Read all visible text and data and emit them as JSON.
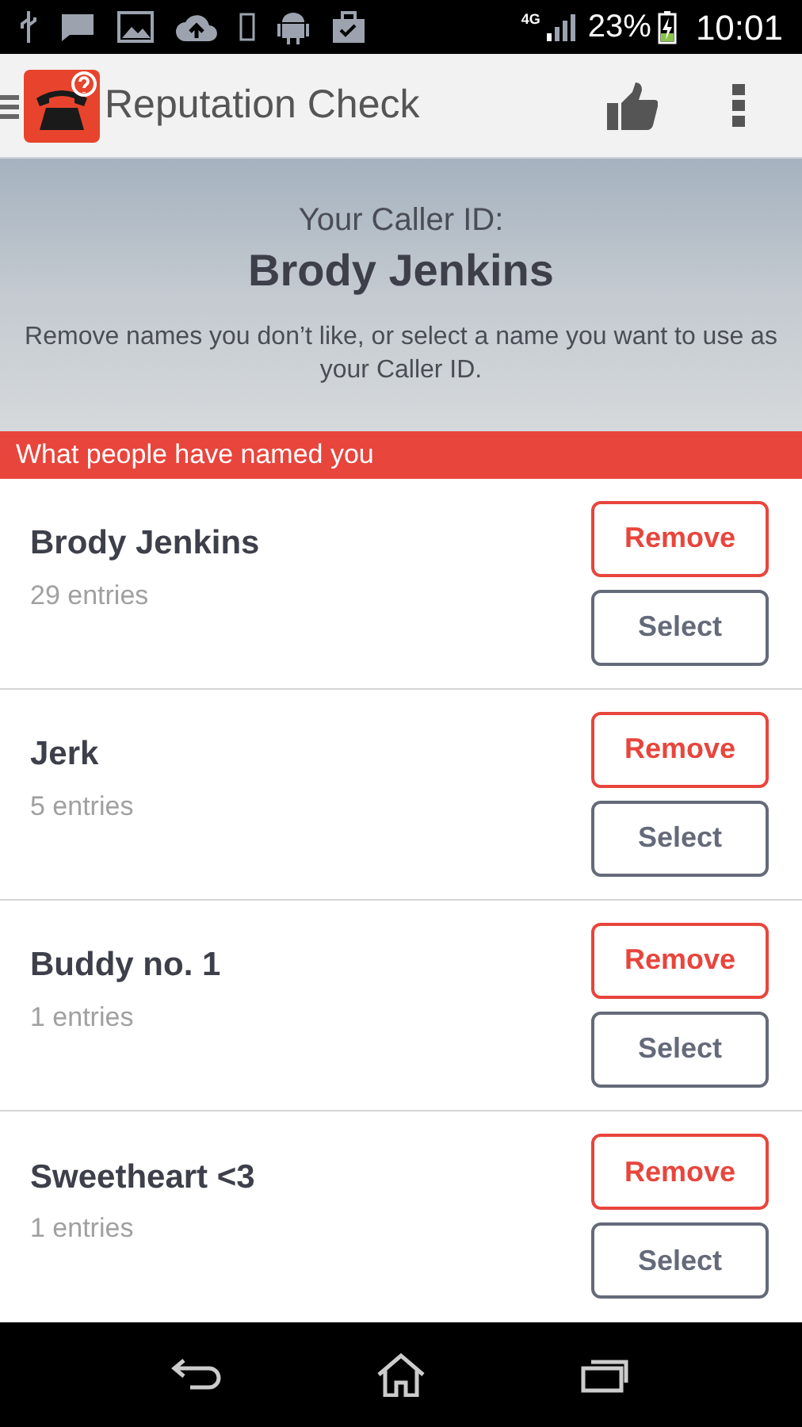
{
  "status_bar": {
    "network": "4G",
    "battery": "23%",
    "time": "10:01"
  },
  "app_bar": {
    "title": "Reputation Check"
  },
  "header": {
    "label": "Your Caller ID:",
    "name": "Brody Jenkins",
    "hint": "Remove names you don’t like, or select a name you want to use as your Caller ID."
  },
  "section": {
    "title": "What people have named you"
  },
  "names": [
    {
      "name": "Brody Jenkins",
      "entries": "29 entries",
      "actions": [
        "Remove",
        "Select"
      ]
    },
    {
      "name": "Jerk",
      "entries": "5 entries",
      "actions": [
        "Remove",
        "Select"
      ]
    },
    {
      "name": "Buddy no. 1",
      "entries": "1 entries",
      "actions": [
        "Remove",
        "Select"
      ]
    },
    {
      "name": "Sweetheart <3",
      "entries": "1 entries",
      "actions": [
        "Remove",
        "Select"
      ]
    }
  ]
}
